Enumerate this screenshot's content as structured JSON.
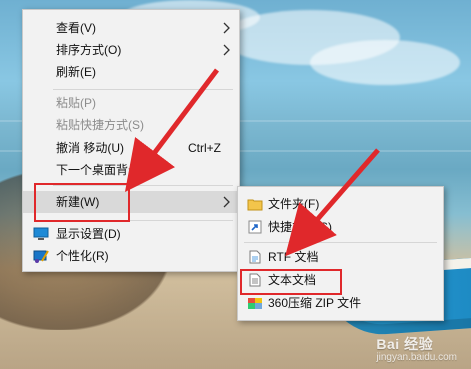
{
  "context_menu": {
    "items": [
      {
        "label": "查看(V)",
        "has_submenu": true,
        "enabled": true
      },
      {
        "label": "排序方式(O)",
        "has_submenu": true,
        "enabled": true
      },
      {
        "label": "刷新(E)",
        "enabled": true
      },
      {
        "label": "粘贴(P)",
        "enabled": false
      },
      {
        "label": "粘贴快捷方式(S)",
        "enabled": false
      },
      {
        "label": "撤消 移动(U)",
        "shortcut": "Ctrl+Z",
        "enabled": true
      },
      {
        "label": "下一个桌面背景(N)",
        "enabled": true
      },
      {
        "label": "新建(W)",
        "has_submenu": true,
        "enabled": true,
        "highlighted": true
      },
      {
        "label": "显示设置(D)",
        "icon": "display-settings-icon",
        "enabled": true
      },
      {
        "label": "个性化(R)",
        "icon": "personalize-icon",
        "enabled": true
      }
    ]
  },
  "new_submenu": {
    "items": [
      {
        "label": "文件夹(F)",
        "icon": "folder-icon"
      },
      {
        "label": "快捷方式(S)",
        "icon": "shortcut-icon"
      },
      {
        "label": "RTF 文档",
        "icon": "rtf-document-icon"
      },
      {
        "label": "文本文档",
        "icon": "text-document-icon"
      },
      {
        "label": "360压缩 ZIP 文件",
        "icon": "zip-archive-icon"
      }
    ]
  },
  "watermark": {
    "logo": "Bai 经验",
    "url": "jingyan.baidu.com"
  },
  "colors": {
    "annotation_red": "#e0282b",
    "menu_bg": "#f2f2f2",
    "hover_bg": "#d9d9d9"
  }
}
